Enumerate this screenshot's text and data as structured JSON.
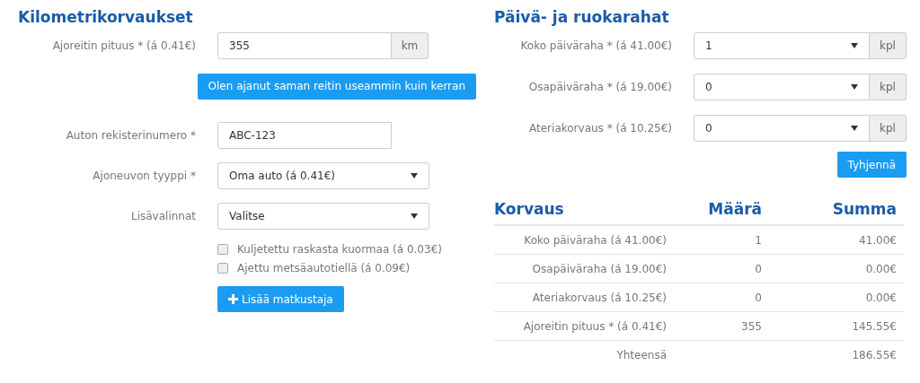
{
  "mileage": {
    "title": "Kilometrikorvaukset",
    "fields": [
      {
        "kind": "input",
        "label": "Ajoreitin pituus * (á 0.41€)",
        "value": "355",
        "addon": "km"
      },
      {
        "kind": "button",
        "label": "Olen ajanut saman reitin useammin kuin kerran"
      },
      {
        "kind": "input",
        "label": "Auton rekisterinumero *",
        "value": "ABC-123"
      },
      {
        "kind": "select",
        "label": "Ajoneuvon tyyppi *",
        "value": "Oma auto (á 0.41€)"
      },
      {
        "kind": "select",
        "label": "Lisävalinnat",
        "value": "Valitse"
      }
    ],
    "checkboxes": [
      {
        "label": "Kuljetettu raskasta kuormaa (á 0.03€)",
        "checked": false
      },
      {
        "label": "Ajettu metsäautotiellä (á 0.09€)",
        "checked": false
      }
    ],
    "add_button": "Lisää matkustaja"
  },
  "allowances": {
    "title": "Päivä- ja ruokarahat",
    "fields": [
      {
        "label": "Koko päiväraha * (á 41.00€)",
        "value": "1",
        "addon": "kpl"
      },
      {
        "label": "Osapäiväraha * (á 19.00€)",
        "value": "0",
        "addon": "kpl"
      },
      {
        "label": "Ateriakorvaus * (á 10.25€)",
        "value": "0",
        "addon": "kpl"
      }
    ],
    "clear_button": "Tyhjennä"
  },
  "summary": {
    "columns": [
      "Korvaus",
      "Määrä",
      "Summa"
    ],
    "rows": [
      [
        "Koko päiväraha (á 41.00€)",
        "1",
        "41.00€"
      ],
      [
        "Osapäiväraha (á 19.00€)",
        "0",
        "0.00€"
      ],
      [
        "Ateriakorvaus (á 10.25€)",
        "0",
        "0.00€"
      ],
      [
        "Ajoreitin pituus * (á 0.41€)",
        "355",
        "145.55€"
      ]
    ],
    "total": {
      "label": "Yhteensä",
      "value": "186.55€"
    }
  }
}
